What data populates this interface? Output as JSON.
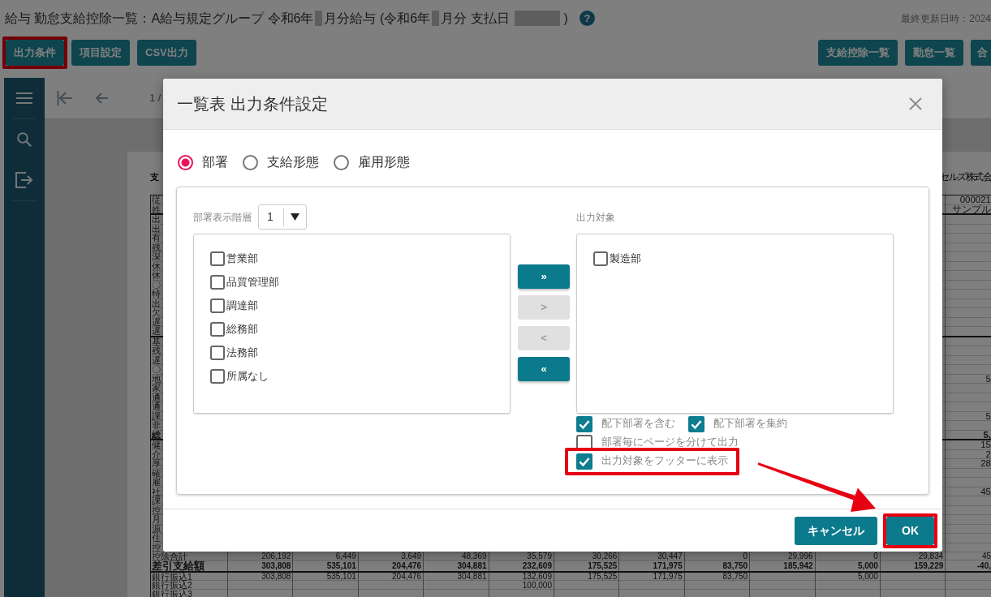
{
  "header": {
    "title_parts": [
      {
        "kind": "text",
        "text": "給与 勤怠支給控除一覧：A給与規定グループ 令和6年"
      },
      {
        "kind": "masked_digit"
      },
      {
        "kind": "text",
        "text": "月分給与 (令和6年"
      },
      {
        "kind": "masked_digit"
      },
      {
        "kind": "text",
        "text": "月分 支払日"
      },
      {
        "kind": "masked_date"
      },
      {
        "kind": "text",
        "text": ")"
      }
    ],
    "help": "?",
    "updated": "最終更新日時：2024"
  },
  "toolbar": {
    "left": [
      {
        "label": "出力条件",
        "highlighted": true
      },
      {
        "label": "項目設定",
        "highlighted": false
      },
      {
        "label": "CSV出力",
        "highlighted": false
      }
    ],
    "right": [
      {
        "label": "支給控除一覧",
        "highlighted": false
      },
      {
        "label": "勤怠一覧",
        "highlighted": false
      },
      {
        "label": "合",
        "highlighted": false
      }
    ]
  },
  "viewer": {
    "page": "1 /"
  },
  "report": {
    "heading": "支",
    "company": "セルズ株式会",
    "sections": [
      {
        "rows": [
          {
            "label": "従",
            "kind": "item",
            "last_column": "000021"
          },
          {
            "label": "姓",
            "kind": "item",
            "last_column": "サンプル"
          }
        ]
      },
      {
        "rows": [
          {
            "label": "出",
            "kind": "item"
          },
          {
            "label": "出",
            "kind": "item"
          },
          {
            "label": "有",
            "kind": "item"
          },
          {
            "label": "残",
            "kind": "item"
          },
          {
            "label": "深",
            "kind": "item"
          },
          {
            "label": "休",
            "kind": "item"
          },
          {
            "label": "休",
            "kind": "item"
          },
          {
            "label": "〇",
            "kind": "item"
          },
          {
            "label": "特",
            "kind": "item"
          },
          {
            "label": "出",
            "kind": "item"
          },
          {
            "label": "欠",
            "kind": "item"
          },
          {
            "label": "遅",
            "kind": "item"
          },
          {
            "label": "遅",
            "kind": "item"
          }
        ]
      },
      {
        "rows": [
          {
            "label": "基",
            "kind": "item"
          },
          {
            "label": "残",
            "kind": "item"
          },
          {
            "label": "遅",
            "kind": "item"
          },
          {
            "label": "〇",
            "kind": "item"
          },
          {
            "label": "地",
            "kind": "item",
            "last_column": "5"
          },
          {
            "label": "家",
            "kind": "item"
          },
          {
            "label": "通",
            "kind": "item"
          },
          {
            "label": "通",
            "kind": "item"
          },
          {
            "label": "課",
            "kind": "item",
            "last_column": "5"
          },
          {
            "label": "非",
            "kind": "item"
          },
          {
            "label": "総",
            "kind": "total",
            "last_column": "5,"
          }
        ]
      },
      {
        "rows": [
          {
            "label": "健",
            "kind": "item",
            "last_column": "15"
          },
          {
            "label": "介",
            "kind": "item",
            "last_column": "2"
          },
          {
            "label": "厚",
            "kind": "item",
            "last_column": "28"
          },
          {
            "label": "確",
            "kind": "item"
          },
          {
            "label": "雇",
            "kind": "item"
          },
          {
            "label": "社",
            "kind": "item",
            "last_column": "45"
          },
          {
            "label": "課",
            "kind": "item"
          },
          {
            "label": "控",
            "kind": "item"
          },
          {
            "label": "月",
            "kind": "item"
          },
          {
            "label": "源",
            "kind": "item"
          },
          {
            "label": "住",
            "kind": "item"
          },
          {
            "label": "控",
            "kind": "item"
          }
        ]
      }
    ],
    "summary_rows": [
      {
        "label": "控除合計",
        "kind": "item",
        "cells": [
          "206,192",
          "6,449",
          "3,649",
          "48,369",
          "35,579",
          "30,266",
          "30,447",
          "0",
          "29,996",
          "0",
          "29,834",
          "45"
        ]
      },
      {
        "label": "差引支給額",
        "kind": "total",
        "cells": [
          "303,808",
          "535,101",
          "204,476",
          "304,881",
          "232,609",
          "175,525",
          "171,975",
          "83,750",
          "185,942",
          "5,000",
          "159,229",
          "-40,"
        ]
      },
      {
        "label": "銀行振込1",
        "kind": "item",
        "cells": [
          "303,808",
          "535,101",
          "204,476",
          "304,881",
          "132,609",
          "175,525",
          "171,975",
          "83,750",
          null,
          "5,000"
        ]
      },
      {
        "label": "銀行振込2",
        "kind": "item",
        "cells": [
          null,
          null,
          null,
          null,
          "100,000"
        ]
      },
      {
        "label": "銀行振込3",
        "kind": "item"
      }
    ]
  },
  "dialog": {
    "title": "一覧表 出力条件設定",
    "modes": [
      {
        "label": "部署",
        "selected": true
      },
      {
        "label": "支給形態",
        "selected": false
      },
      {
        "label": "雇用形態",
        "selected": false
      }
    ],
    "hierarchy_label": "部署表示階層",
    "hierarchy_value": "1",
    "available": [
      {
        "label": "営業部",
        "checked": false
      },
      {
        "label": "品質管理部",
        "checked": false
      },
      {
        "label": "調達部",
        "checked": false
      },
      {
        "label": "総務部",
        "checked": false
      },
      {
        "label": "法務部",
        "checked": false
      },
      {
        "label": "所属なし",
        "checked": false
      }
    ],
    "move_buttons": [
      {
        "label": "»",
        "disabled": false
      },
      {
        "label": ">",
        "disabled": true
      },
      {
        "label": "<",
        "disabled": true
      },
      {
        "label": "«",
        "disabled": false
      }
    ],
    "target_label": "出力対象",
    "targets": [
      {
        "label": "製造部",
        "checked": false
      }
    ],
    "option_rows": [
      [
        {
          "label": "配下部署を含む",
          "checked": true,
          "highlighted": false
        },
        {
          "label": "配下部署を集約",
          "checked": true,
          "highlighted": false
        }
      ],
      [
        {
          "label": "部署毎にページを分けて出力",
          "checked": false,
          "highlighted": false
        }
      ],
      [
        {
          "label": "出力対象をフッターに表示",
          "checked": true,
          "highlighted": true
        }
      ]
    ],
    "buttons": [
      {
        "label": "キャンセル",
        "highlighted": false
      },
      {
        "label": "OK",
        "highlighted": true
      }
    ]
  }
}
